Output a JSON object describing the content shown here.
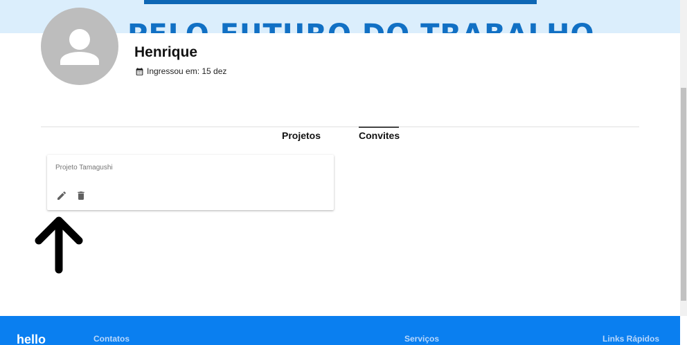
{
  "banner": {
    "text": "PELO FUTURO DO TRABALHO"
  },
  "profile": {
    "name": "Henrique",
    "joined": "Ingressou em: 15 dez",
    "avatar_icon": "person-icon",
    "calendar_icon": "calendar-icon"
  },
  "tabs": [
    {
      "label": "Projetos",
      "active": false
    },
    {
      "label": "Convites",
      "active": true
    }
  ],
  "card": {
    "title": "Projeto Tamagushi",
    "edit_icon": "pencil-icon",
    "delete_icon": "trash-icon"
  },
  "annotation": {
    "icon": "arrow-up-icon",
    "color": "#000000"
  },
  "footer": {
    "logo": "hello",
    "links": [
      "Contatos",
      "Serviços",
      "Links Rápidos"
    ]
  },
  "colors": {
    "banner_bg": "#dbeefc",
    "banner_text": "#1170c4",
    "footer_bg": "#0a7ff0",
    "avatar_bg": "#bdbdbd"
  }
}
